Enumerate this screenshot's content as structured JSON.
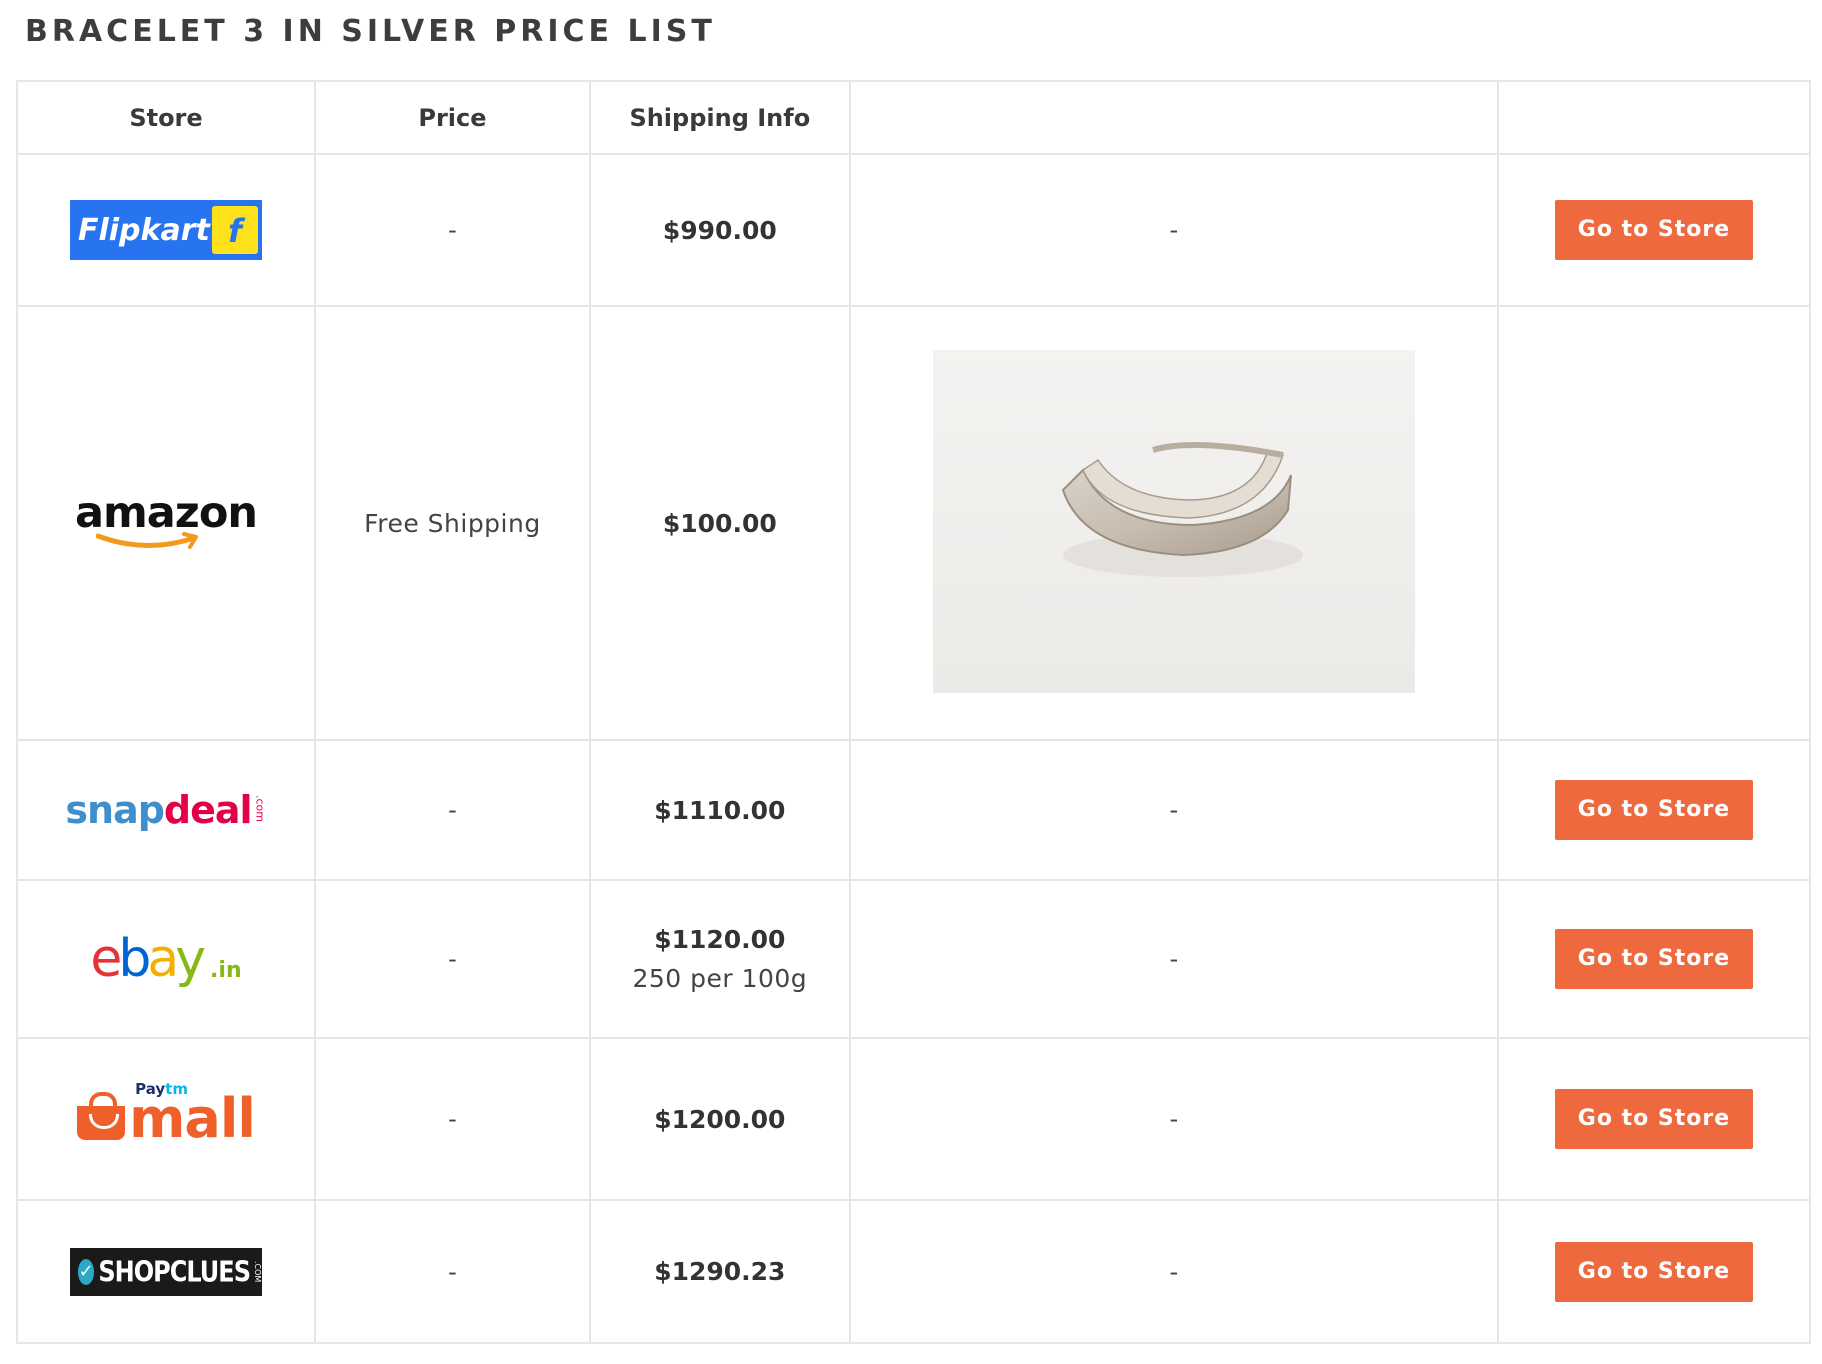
{
  "page": {
    "title": "BRACELET 3 IN SILVER PRICE LIST"
  },
  "table": {
    "headers": {
      "store": "Store",
      "price": "Price",
      "shipping": "Shipping Info",
      "image": "",
      "action": ""
    },
    "rows": [
      {
        "store": "Flipkart",
        "price": "-",
        "shipping": "$990.00",
        "shipping_note": "",
        "image": "-",
        "button": "Go to Store"
      },
      {
        "store": "amazon",
        "price": "Free Shipping",
        "shipping": "$100.00",
        "shipping_note": "",
        "image": "silver-bracelet-photo",
        "button": ""
      },
      {
        "store": "snapdeal",
        "price": "-",
        "shipping": "$1110.00",
        "shipping_note": "",
        "image": "-",
        "button": "Go to Store"
      },
      {
        "store": "ebay",
        "price": "-",
        "shipping": "$1120.00",
        "shipping_note": "250 per 100g",
        "image": "-",
        "button": "Go to Store"
      },
      {
        "store": "mall",
        "price": "-",
        "shipping": "$1200.00",
        "shipping_note": "",
        "image": "-",
        "button": "Go to Store"
      },
      {
        "store": "SHOPCLUES",
        "price": "-",
        "shipping": "$1290.23",
        "shipping_note": "",
        "image": "-",
        "button": "Go to Store"
      }
    ]
  },
  "logos": {
    "flipkart": {
      "word": "Flipkart",
      "mark": "f"
    },
    "amazon": {
      "word": "amazon"
    },
    "snapdeal": {
      "snap": "snap",
      "deal": "deal",
      "com": ".com"
    },
    "ebay": {
      "e": "e",
      "b": "b",
      "a": "a",
      "y": "y",
      "tld": ".in"
    },
    "paytm": {
      "p1": "Pay",
      "p2": "tm",
      "mall": "mall"
    },
    "shopclues": {
      "word": "SHOPCLUES",
      "com": ".COM"
    }
  },
  "colors": {
    "button_bg": "#ee6a3e",
    "border": "#e6e6e6",
    "flipkart_blue": "#2874f0",
    "flipkart_yellow": "#ffe11b",
    "snapdeal_blue": "#3f8fcd",
    "snapdeal_red": "#e40046",
    "paytm_orange": "#ef5f2a"
  },
  "icons": {
    "checkmark": "check-icon",
    "shopping_bag": "shopping-bag-icon",
    "amazon_smile": "amazon-smile-arrow-icon"
  }
}
